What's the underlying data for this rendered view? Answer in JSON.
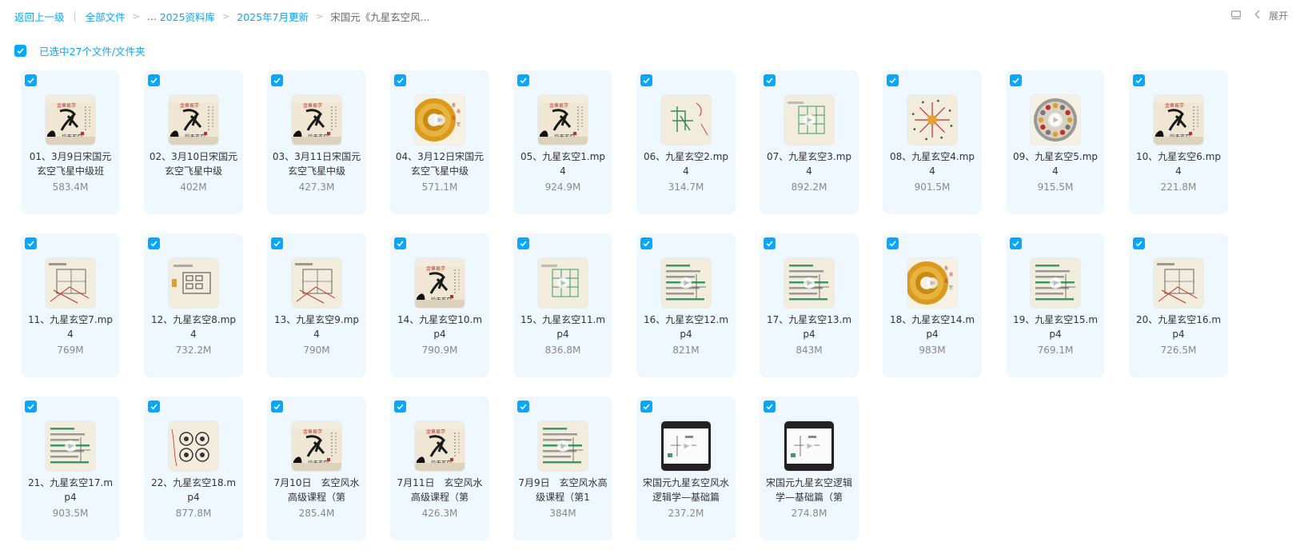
{
  "breadcrumb": {
    "back": "返回上一级",
    "all_files": "全部文件",
    "ellipsis": "...",
    "level1": "2025资料库",
    "level2": "2025年7月更新",
    "current": "宋国元《九星玄空风..."
  },
  "toolbar": {
    "expand_label": "展开",
    "list_icon": "list-view-icon",
    "collapse_icon": "chevron-left-icon"
  },
  "selection": {
    "label": "已选中27个文件/文件夹"
  },
  "accent_color": "#06a7ff",
  "files": [
    {
      "name": "01、3月9日宋国元玄空飞星中级班",
      "size": "583.4M",
      "thumb": "calligraphy"
    },
    {
      "name": "02、3月10日宋国元玄空飞星中级",
      "size": "402M",
      "thumb": "calligraphy"
    },
    {
      "name": "03、3月11日宋国元玄空飞星中级",
      "size": "427.3M",
      "thumb": "calligraphy"
    },
    {
      "name": "04、3月12日宋国元玄空飞星中级",
      "size": "571.1M",
      "thumb": "luopan"
    },
    {
      "name": "05、九星玄空1.mp4",
      "size": "924.9M",
      "thumb": "calligraphy"
    },
    {
      "name": "06、九星玄空2.mp4",
      "size": "314.7M",
      "thumb": "sketch-green"
    },
    {
      "name": "07、九星玄空3.mp4",
      "size": "892.2M",
      "thumb": "grid"
    },
    {
      "name": "08、九星玄空4.mp4",
      "size": "901.5M",
      "thumb": "star"
    },
    {
      "name": "09、九星玄空5.mp4",
      "size": "915.5M",
      "thumb": "wheel"
    },
    {
      "name": "10、九星玄空6.mp4",
      "size": "221.8M",
      "thumb": "calligraphy"
    },
    {
      "name": "11、九星玄空7.mp4",
      "size": "769M",
      "thumb": "sketch-red"
    },
    {
      "name": "12、九星玄空8.mp4",
      "size": "732.2M",
      "thumb": "boxes"
    },
    {
      "name": "13、九星玄空9.mp4",
      "size": "790M",
      "thumb": "sketch-red"
    },
    {
      "name": "14、九星玄空10.mp4",
      "size": "790.9M",
      "thumb": "calligraphy"
    },
    {
      "name": "15、九星玄空11.mp4",
      "size": "836.8M",
      "thumb": "grid"
    },
    {
      "name": "16、九星玄空12.mp4",
      "size": "821M",
      "thumb": "text"
    },
    {
      "name": "17、九星玄空13.mp4",
      "size": "843M",
      "thumb": "text"
    },
    {
      "name": "18、九星玄空14.mp4",
      "size": "983M",
      "thumb": "luopan"
    },
    {
      "name": "19、九星玄空15.mp4",
      "size": "769.1M",
      "thumb": "text"
    },
    {
      "name": "20、九星玄空16.mp4",
      "size": "726.5M",
      "thumb": "sketch-red"
    },
    {
      "name": "21、九星玄空17.mp4",
      "size": "903.5M",
      "thumb": "text"
    },
    {
      "name": "22、九星玄空18.mp4",
      "size": "877.8M",
      "thumb": "circles"
    },
    {
      "name": "7月10日　玄空风水高级课程（第",
      "size": "285.4M",
      "thumb": "calligraphy"
    },
    {
      "name": "7月11日　玄空风水高级课程（第",
      "size": "426.3M",
      "thumb": "calligraphy"
    },
    {
      "name": "7月9日　玄空风水高级课程（第1",
      "size": "384M",
      "thumb": "text"
    },
    {
      "name": "宋国元九星玄空风水逻辑学—基础篇",
      "size": "237.2M",
      "thumb": "dark"
    },
    {
      "name": "宋国元九星玄空逻辑学—基础篇（第",
      "size": "274.8M",
      "thumb": "dark"
    }
  ]
}
